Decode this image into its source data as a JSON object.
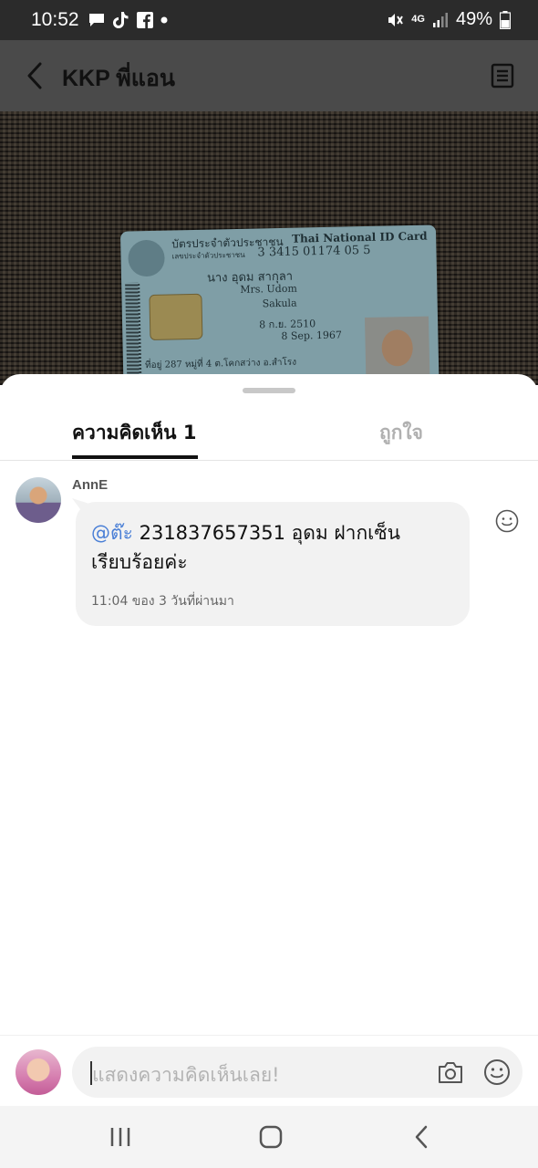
{
  "status_bar": {
    "time": "10:52",
    "left_icons": [
      "chat-icon",
      "tiktok-icon",
      "facebook-icon",
      "dot-icon"
    ],
    "network": "4G",
    "battery": "49%"
  },
  "header": {
    "title": "KKP พี่แอน",
    "back_icon": "back-arrow-icon",
    "menu_icon": "menu-list-icon"
  },
  "photo": {
    "card": {
      "title_th": "บัตรประจำตัวประชาชน",
      "title_en": "Thai National ID Card",
      "id_label": "เลขประจำตัวประชาชน",
      "id_number": "3 3415 01174 05 5",
      "name_th": "นาง อุดม สากุลา",
      "name_en": "Mrs. Udom",
      "last_name_en": "Sakula",
      "dob_th": "8 ก.ย. 2510",
      "dob_en": "8 Sep. 1967",
      "address": "ที่อยู่ 287 หมู่ที่ 4 ต.โคกสว่าง อ.สำโรง"
    }
  },
  "sheet": {
    "tabs": [
      {
        "label": "ความคิดเห็น 1",
        "active": true
      },
      {
        "label": "ถูกใจ",
        "active": false
      }
    ],
    "comments": [
      {
        "author": "AnnE",
        "mention": "@ต๊ะ",
        "text": " 231837657351 อุดม ฝากเซ็นเรียบร้อยค่ะ",
        "time": "11:04 ของ 3 วันที่ผ่านมา"
      }
    ]
  },
  "input": {
    "placeholder": "แสดงความคิดเห็นเลย!",
    "camera_icon": "camera-icon",
    "emoji_icon": "emoji-icon"
  },
  "nav": {
    "buttons": [
      "recents-icon",
      "home-icon",
      "back-icon"
    ]
  },
  "colors": {
    "mention": "#4a7fd6",
    "inactive_tab": "#b0b0b0",
    "bubble": "#f2f2f2"
  }
}
